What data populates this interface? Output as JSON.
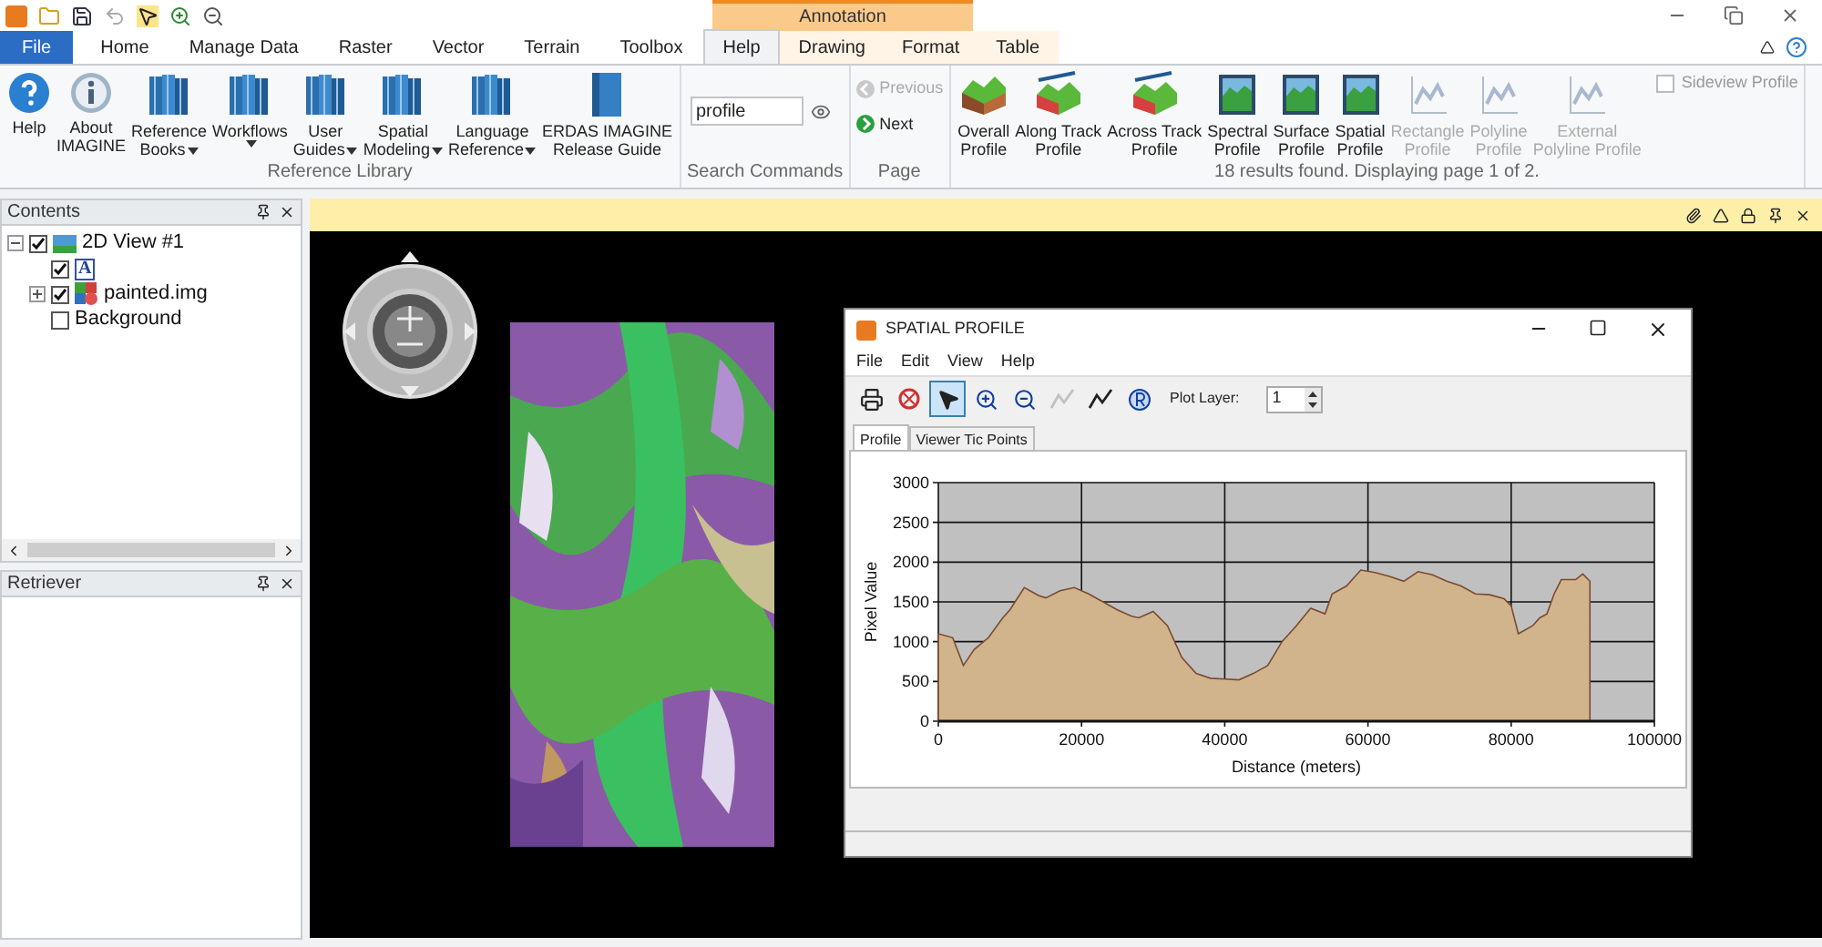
{
  "contextual_group": {
    "label": "Annotation"
  },
  "file_button": {
    "label": "File"
  },
  "tabs": [
    {
      "label": "Home",
      "kind": "tab",
      "selected": false
    },
    {
      "label": "Manage Data",
      "kind": "tab",
      "selected": false
    },
    {
      "label": "Raster",
      "kind": "tab",
      "selected": false
    },
    {
      "label": "Vector",
      "kind": "tab",
      "selected": false
    },
    {
      "label": "Terrain",
      "kind": "tab",
      "selected": false
    },
    {
      "label": "Toolbox",
      "kind": "tab",
      "selected": false
    },
    {
      "label": "Help",
      "kind": "tab",
      "selected": true
    },
    {
      "label": "Drawing",
      "kind": "contextual",
      "selected": false
    },
    {
      "label": "Format",
      "kind": "contextual",
      "selected": false
    },
    {
      "label": "Table",
      "kind": "contextual",
      "selected": false
    }
  ],
  "reference_library": {
    "label": "Reference Library",
    "buttons": [
      {
        "lines": [
          "Help"
        ],
        "kind": "help",
        "dropdown": false
      },
      {
        "lines": [
          "About",
          "IMAGINE"
        ],
        "kind": "info",
        "dropdown": false
      },
      {
        "lines": [
          "Reference",
          "Books"
        ],
        "kind": "books",
        "dropdown": true
      },
      {
        "lines": [
          "Workflows"
        ],
        "kind": "books",
        "dropdown": true
      },
      {
        "lines": [
          "User",
          "Guides"
        ],
        "kind": "books",
        "dropdown": true
      },
      {
        "lines": [
          "Spatial",
          "Modeling"
        ],
        "kind": "books",
        "dropdown": true
      },
      {
        "lines": [
          "Language",
          "Reference"
        ],
        "kind": "books",
        "dropdown": true
      },
      {
        "lines": [
          "ERDAS IMAGINE",
          "Release Guide"
        ],
        "kind": "book",
        "dropdown": false
      }
    ]
  },
  "search_commands": {
    "label": "Search Commands",
    "value": "profile"
  },
  "page": {
    "label": "Page",
    "buttons": [
      {
        "label": "Previous",
        "disabled": true
      },
      {
        "label": "Next",
        "disabled": false
      }
    ]
  },
  "profiles": {
    "label": "18 results found.  Displaying page 1 of 2.",
    "buttons": [
      {
        "lines": [
          "Overall",
          "Profile"
        ],
        "kind": "terrain",
        "disabled": false
      },
      {
        "lines": [
          "Along Track",
          "Profile"
        ],
        "kind": "track",
        "disabled": false
      },
      {
        "lines": [
          "Across Track",
          "Profile"
        ],
        "kind": "track",
        "disabled": false
      },
      {
        "lines": [
          "Spectral",
          "Profile"
        ],
        "kind": "chart",
        "disabled": false
      },
      {
        "lines": [
          "Surface",
          "Profile"
        ],
        "kind": "chart",
        "disabled": false
      },
      {
        "lines": [
          "Spatial",
          "Profile"
        ],
        "kind": "chart",
        "disabled": false
      },
      {
        "lines": [
          "Rectangle",
          "Profile"
        ],
        "kind": "chart",
        "disabled": true
      },
      {
        "lines": [
          "Polyline",
          "Profile"
        ],
        "kind": "chart",
        "disabled": true
      },
      {
        "lines": [
          "External",
          "Polyline Profile"
        ],
        "kind": "chart",
        "disabled": true
      }
    ],
    "checkbox": {
      "label": "Sideview Profile",
      "checked": false,
      "disabled": true
    }
  },
  "contents": {
    "title": "Contents",
    "tree": [
      {
        "label": "2D View #1",
        "kind": "view",
        "checked": true,
        "expanded": true,
        "children": [
          {
            "label": "A",
            "kind": "annotation",
            "checked": true
          },
          {
            "label": "painted.img",
            "kind": "raster",
            "checked": true,
            "expanded": false
          },
          {
            "label": "Background",
            "kind": "background",
            "checked": false
          }
        ]
      }
    ]
  },
  "retriever": {
    "title": "Retriever"
  },
  "profile_window": {
    "title": "SPATIAL PROFILE",
    "menu": [
      "File",
      "Edit",
      "View",
      "Help"
    ],
    "tools": [
      {
        "kind": "print",
        "selected": false,
        "disabled": false
      },
      {
        "kind": "clear",
        "selected": false,
        "disabled": false
      },
      {
        "kind": "select",
        "selected": true,
        "disabled": false
      },
      {
        "kind": "zoom-in",
        "selected": false,
        "disabled": false
      },
      {
        "kind": "zoom-out",
        "selected": false,
        "disabled": false
      },
      {
        "kind": "line",
        "selected": false,
        "disabled": true
      },
      {
        "kind": "line",
        "selected": false,
        "disabled": false
      },
      {
        "kind": "r",
        "selected": false,
        "disabled": false
      }
    ],
    "plot_layer": {
      "label": "Plot Layer:",
      "value": "1"
    },
    "tabs": [
      {
        "label": "Profile",
        "selected": true
      },
      {
        "label": "Viewer Tic Points",
        "selected": false
      }
    ],
    "chart_data": {
      "type": "area",
      "xlabel": "Distance (meters)",
      "ylabel": "Pixel Value",
      "x": [
        0,
        2000,
        3500,
        5000,
        7000,
        9000,
        10000,
        12000,
        14000,
        15000,
        17000,
        19000,
        21000,
        23000,
        25000,
        27000,
        28000,
        30000,
        32000,
        34000,
        36000,
        38000,
        40000,
        42000,
        44000,
        46000,
        48000,
        50000,
        52000,
        54000,
        55000,
        57000,
        59000,
        61000,
        63000,
        65000,
        67000,
        69000,
        71000,
        73000,
        75000,
        77000,
        79000,
        80000,
        81000,
        83000,
        84000,
        85000,
        86000,
        87000,
        89000,
        90000,
        91000
      ],
      "grid": true,
      "series": [
        {
          "color": "#d2b48c",
          "values": [
            1100,
            1050,
            700,
            900,
            1050,
            1300,
            1400,
            1680,
            1580,
            1550,
            1640,
            1680,
            1600,
            1500,
            1400,
            1320,
            1300,
            1380,
            1200,
            800,
            600,
            540,
            530,
            520,
            600,
            700,
            1000,
            1200,
            1420,
            1350,
            1600,
            1700,
            1900,
            1870,
            1820,
            1760,
            1880,
            1840,
            1760,
            1700,
            1600,
            1590,
            1540,
            1450,
            1100,
            1200,
            1300,
            1350,
            1600,
            1780,
            1780,
            1850,
            1760
          ]
        }
      ],
      "xlim": [
        0,
        100000
      ],
      "ylim": [
        0,
        3000
      ],
      "xticks": [
        0,
        20000,
        40000,
        60000,
        80000,
        100000
      ],
      "yticks": [
        0,
        500,
        1000,
        1500,
        2000,
        2500,
        3000
      ]
    }
  }
}
